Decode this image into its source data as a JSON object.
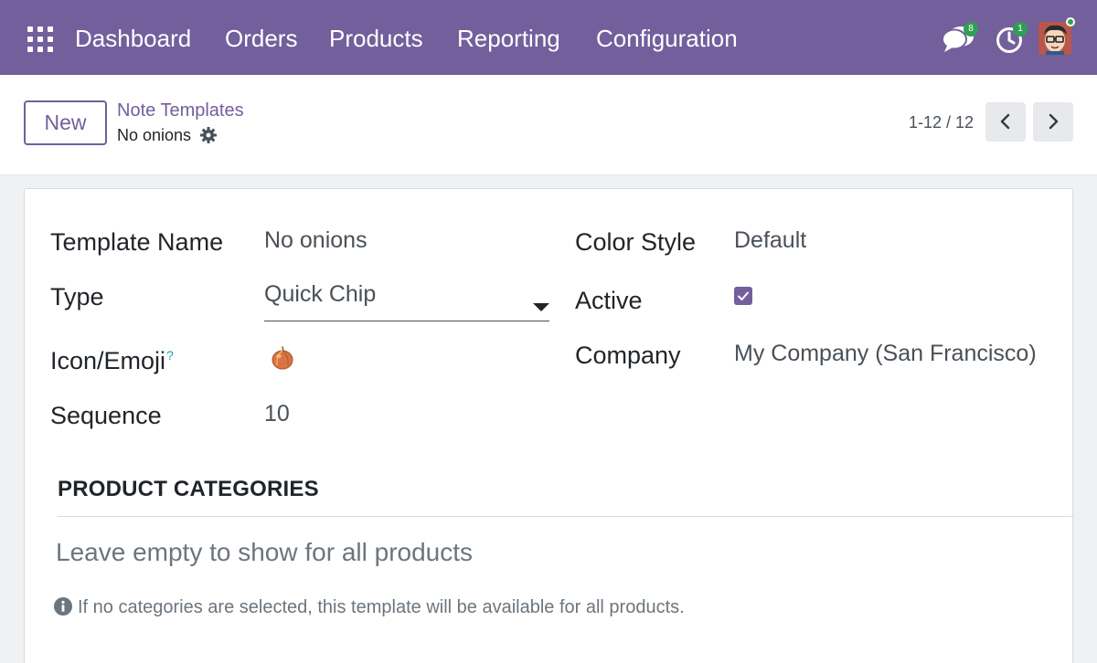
{
  "navbar": {
    "apps_icon": "apps-grid-icon",
    "menu": [
      "Dashboard",
      "Orders",
      "Products",
      "Reporting",
      "Configuration"
    ],
    "chat_badge": "8",
    "activity_badge": "1",
    "accent_color": "#735f9c"
  },
  "control_panel": {
    "new_label": "New",
    "breadcrumb": "Note Templates",
    "record_name": "No onions",
    "pager": "1-12 / 12"
  },
  "form": {
    "template_name_label": "Template Name",
    "template_name_value": "No onions",
    "type_label": "Type",
    "type_value": "Quick Chip",
    "icon_label": "Icon/Emoji",
    "icon_help": "?",
    "icon_value": "onion",
    "sequence_label": "Sequence",
    "sequence_value": "10",
    "color_style_label": "Color Style",
    "color_style_value": "Default",
    "active_label": "Active",
    "active_checked": true,
    "company_label": "Company",
    "company_value": "My Company (San Francisco)"
  },
  "categories": {
    "title": "PRODUCT CATEGORIES",
    "placeholder": "Leave empty to show for all products",
    "info": "If no categories are selected, this template will be available for all products."
  }
}
